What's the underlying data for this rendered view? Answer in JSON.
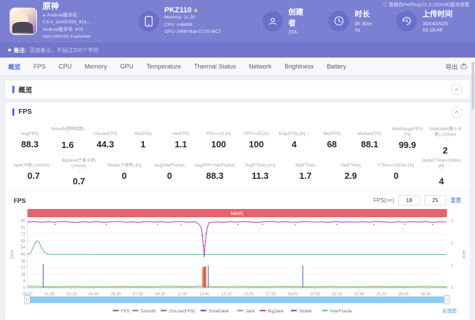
{
  "header": {
    "app": {
      "name": "原神",
      "version_name": "Android版本名: 5.5.0_31400259_314...",
      "version_code": "Android版本号: 979",
      "package": "com.miHoYo.Yuanshen"
    },
    "device": {
      "model": "PKZ110",
      "memory": "Memory: 11.20",
      "cpu": "CPU: mt6899",
      "gpu": "GPU: ARM Mali-G720 MC7"
    },
    "creator": {
      "label": "创建者",
      "value": "ZOL"
    },
    "duration": {
      "label": "时长",
      "value": "0h 30m 2s"
    },
    "upload": {
      "label": "上传时间",
      "value": "30/04/2025 16:18:48"
    },
    "collector_note": "数据由PerfDog(11.2.250436)版本收集"
  },
  "note_bar": {
    "label": "备注:",
    "placeholder": "添加备注，不超过200个字符"
  },
  "tabs": {
    "items": [
      {
        "label": "概览",
        "active": true
      },
      {
        "label": "FPS",
        "active": false
      },
      {
        "label": "CPU",
        "active": false
      },
      {
        "label": "Memory",
        "active": false
      },
      {
        "label": "GPU",
        "active": false
      },
      {
        "label": "Temperature",
        "active": false
      },
      {
        "label": "Thermal Status",
        "active": false
      },
      {
        "label": "Network",
        "active": false
      },
      {
        "label": "Brightness",
        "active": false
      },
      {
        "label": "Battery",
        "active": false
      }
    ],
    "export_label": "导出"
  },
  "overview_section": {
    "title": "概览"
  },
  "fps_section": {
    "title": "FPS",
    "stats_row1": [
      {
        "label": "Avg(FPS)",
        "value": "88.3",
        "info": false
      },
      {
        "label": "Smooth(顺畅指数)",
        "value": "1.6",
        "info": true
      },
      {
        "label": "1%Low(FPS)",
        "value": "44.3",
        "info": false
      },
      {
        "label": "Std(FPS)",
        "value": "1",
        "info": false
      },
      {
        "label": "Var(FPS)",
        "value": "1.1",
        "info": false
      },
      {
        "label": "FPS>=18 [%]",
        "value": "100",
        "info": false
      },
      {
        "label": "FPS>=25 [%]",
        "value": "100",
        "info": false
      },
      {
        "label": "Drop(FPS) [/h]",
        "value": "4",
        "info": true
      },
      {
        "label": "Min(FPS)",
        "value": "68",
        "info": false
      },
      {
        "label": "Median(FPS)",
        "value": "88.1",
        "info": false
      },
      {
        "label": "MedRange(FPS)[%]",
        "value": "99.9",
        "info": false
      },
      {
        "label": "SmallJank(微小卡顿) (/10min)",
        "value": "2",
        "info": true
      }
    ],
    "stats_row2": [
      {
        "label": "Jank(卡顿) (/10min)",
        "value": "0.7",
        "info": true
      },
      {
        "label": "BigJank(严重卡顿) (/10min)",
        "value": "0.7",
        "info": true
      },
      {
        "label": "Stutter(卡顿率) [%]",
        "value": "0",
        "info": false
      },
      {
        "label": "Avg(InterFrame)",
        "value": "0",
        "info": false
      },
      {
        "label": "Avg(FPS+InterFrame)",
        "value": "88.3",
        "info": false
      },
      {
        "label": "Avg(FTime) [ms]",
        "value": "11.3",
        "info": false
      },
      {
        "label": "Std(FTime)",
        "value": "1.7",
        "info": false
      },
      {
        "label": "Var(FTime)",
        "value": "2.9",
        "info": false
      },
      {
        "label": "FTime>=100ms [%]",
        "value": "0",
        "info": false
      },
      {
        "label": "Delta(FTime)>100ms [/h]",
        "value": "4",
        "info": true
      }
    ],
    "chart_controls": {
      "title": "FPS",
      "filter_label": "FPS(>=)",
      "input1": "18",
      "input2": "25",
      "reset_label": "重置",
      "select_all_label": "全选图"
    }
  },
  "chart_data": {
    "type": "line",
    "title": "FPS",
    "duration_s": 1802,
    "annotation": {
      "label": "label1",
      "color": "#e5636e"
    },
    "left_axis": {
      "label": "FPS",
      "min": 0,
      "max": 90,
      "ticks": [
        0,
        9,
        18,
        27,
        36,
        45,
        54,
        63,
        72,
        81,
        90
      ]
    },
    "right_axis": {
      "label": "Jank",
      "min": 0,
      "max": 3,
      "ticks": [
        0,
        1,
        2,
        3
      ]
    },
    "x_ticks": [
      {
        "t": 0,
        "label": "00:00"
      },
      {
        "t": 95,
        "label": "01:35"
      },
      {
        "t": 190,
        "label": "03:10"
      },
      {
        "t": 285,
        "label": "04:45"
      },
      {
        "t": 380,
        "label": "06:20"
      },
      {
        "t": 475,
        "label": "07:55"
      },
      {
        "t": 570,
        "label": "09:30"
      },
      {
        "t": 665,
        "label": "11:05"
      },
      {
        "t": 760,
        "label": "12:40"
      },
      {
        "t": 855,
        "label": "14:15"
      },
      {
        "t": 950,
        "label": "15:50"
      },
      {
        "t": 1045,
        "label": "17:25"
      },
      {
        "t": 1140,
        "label": "19:00"
      },
      {
        "t": 1235,
        "label": "20:35"
      },
      {
        "t": 1330,
        "label": "22:10"
      },
      {
        "t": 1425,
        "label": "23:45"
      },
      {
        "t": 1520,
        "label": "25:20"
      },
      {
        "t": 1615,
        "label": "26:55"
      },
      {
        "t": 1710,
        "label": "28:30"
      }
    ],
    "series": [
      {
        "name": "FPS",
        "color": "#c155ae",
        "axis": "left",
        "type": "line",
        "points": [
          [
            0,
            88.2
          ],
          [
            30,
            88.8
          ],
          [
            60,
            87.9
          ],
          [
            90,
            88.5
          ],
          [
            120,
            88.0
          ],
          [
            150,
            88.9
          ],
          [
            180,
            88.3
          ],
          [
            210,
            87.6
          ],
          [
            240,
            88.6
          ],
          [
            270,
            88.1
          ],
          [
            300,
            88.7
          ],
          [
            330,
            87.8
          ],
          [
            360,
            88.4
          ],
          [
            390,
            88.9
          ],
          [
            420,
            88.0
          ],
          [
            450,
            88.5
          ],
          [
            480,
            87.7
          ],
          [
            510,
            88.8
          ],
          [
            540,
            88.2
          ],
          [
            570,
            88.6
          ],
          [
            600,
            87.9
          ],
          [
            630,
            88.4
          ],
          [
            660,
            88.8
          ],
          [
            690,
            88.1
          ],
          [
            720,
            88.5
          ],
          [
            735,
            86.0
          ],
          [
            748,
            80.0
          ],
          [
            756,
            55.0
          ],
          [
            760,
            41.0
          ],
          [
            764,
            62.0
          ],
          [
            772,
            80.0
          ],
          [
            780,
            87.5
          ],
          [
            810,
            88.3
          ],
          [
            840,
            87.8
          ],
          [
            870,
            88.6
          ],
          [
            900,
            88.0
          ],
          [
            930,
            88.7
          ],
          [
            960,
            88.2
          ],
          [
            990,
            87.7
          ],
          [
            1020,
            88.5
          ],
          [
            1050,
            88.9
          ],
          [
            1080,
            88.1
          ],
          [
            1110,
            88.6
          ],
          [
            1140,
            87.9
          ],
          [
            1170,
            88.3
          ],
          [
            1200,
            88.8
          ],
          [
            1230,
            88.0
          ],
          [
            1260,
            88.4
          ],
          [
            1290,
            87.8
          ],
          [
            1320,
            88.7
          ],
          [
            1350,
            88.2
          ],
          [
            1380,
            88.5
          ],
          [
            1410,
            87.9
          ],
          [
            1440,
            88.6
          ],
          [
            1470,
            88.1
          ],
          [
            1500,
            88.8
          ],
          [
            1530,
            88.3
          ],
          [
            1560,
            87.7
          ],
          [
            1590,
            88.5
          ],
          [
            1620,
            88.0
          ],
          [
            1650,
            88.6
          ],
          [
            1680,
            88.2
          ],
          [
            1710,
            88.7
          ],
          [
            1740,
            87.9
          ],
          [
            1770,
            88.4
          ],
          [
            1800,
            88.1
          ]
        ]
      },
      {
        "name": "Smooth",
        "color": "#84a055",
        "axis": "left",
        "type": "line",
        "points": [
          [
            0,
            2.2
          ],
          [
            100,
            1.4
          ],
          [
            200,
            1.9
          ],
          [
            300,
            1.3
          ],
          [
            400,
            1.8
          ],
          [
            500,
            1.4
          ],
          [
            600,
            2.0
          ],
          [
            700,
            1.4
          ],
          [
            760,
            2.6
          ],
          [
            800,
            1.5
          ],
          [
            900,
            1.9
          ],
          [
            1000,
            1.4
          ],
          [
            1100,
            1.8
          ],
          [
            1200,
            1.4
          ],
          [
            1300,
            1.9
          ],
          [
            1400,
            1.5
          ],
          [
            1500,
            1.8
          ],
          [
            1600,
            1.4
          ],
          [
            1700,
            1.9
          ],
          [
            1802,
            1.5
          ]
        ]
      },
      {
        "name": "1%Low(FPS)",
        "color": "#45a09b",
        "axis": "left",
        "type": "line",
        "points": [
          [
            0,
            45.3
          ],
          [
            12,
            46.0
          ],
          [
            22,
            52.0
          ],
          [
            32,
            60.0
          ],
          [
            40,
            63.0
          ],
          [
            50,
            61.0
          ],
          [
            60,
            54.0
          ],
          [
            72,
            48.0
          ],
          [
            85,
            45.5
          ],
          [
            100,
            44.7
          ],
          [
            200,
            44.7
          ],
          [
            400,
            44.6
          ],
          [
            800,
            44.6
          ],
          [
            1200,
            44.6
          ],
          [
            1802,
            44.6
          ]
        ]
      },
      {
        "name": "SmallJank",
        "color": "#5a62d8",
        "axis": "right",
        "type": "spike",
        "points": [
          [
            68,
            1.05
          ]
        ]
      },
      {
        "name": "Jank",
        "color": "#e8953f",
        "axis": "right",
        "type": "bar",
        "points": [
          [
            756,
            0.9
          ]
        ]
      },
      {
        "name": "BigJank",
        "color": "#e0524a",
        "axis": "right",
        "type": "bar",
        "points": [
          [
            762,
            0.95
          ]
        ]
      },
      {
        "name": "Stutter",
        "color": "#4a78d8",
        "axis": "right",
        "type": "spike",
        "points": [
          [
            777,
            1.0
          ],
          [
            1183,
            1.0
          ]
        ]
      },
      {
        "name": "InterFrame",
        "color": "#55c8d5",
        "axis": "left",
        "type": "line",
        "points": [
          [
            0,
            0.2
          ],
          [
            1802,
            0.2
          ]
        ]
      }
    ],
    "fps_outliers": [
      [
        120,
        85.2
      ],
      [
        340,
        84.7
      ],
      [
        560,
        85.0
      ],
      [
        660,
        84.5
      ],
      [
        755,
        70
      ],
      [
        758,
        56
      ],
      [
        762,
        48
      ],
      [
        766,
        73
      ],
      [
        905,
        84.8
      ],
      [
        1010,
        85.1
      ],
      [
        1150,
        84.4
      ],
      [
        1330,
        85.0
      ],
      [
        1490,
        84.6
      ],
      [
        1620,
        85.2
      ],
      [
        1740,
        84.8
      ]
    ],
    "legend_position": "bottom",
    "grid": true
  }
}
